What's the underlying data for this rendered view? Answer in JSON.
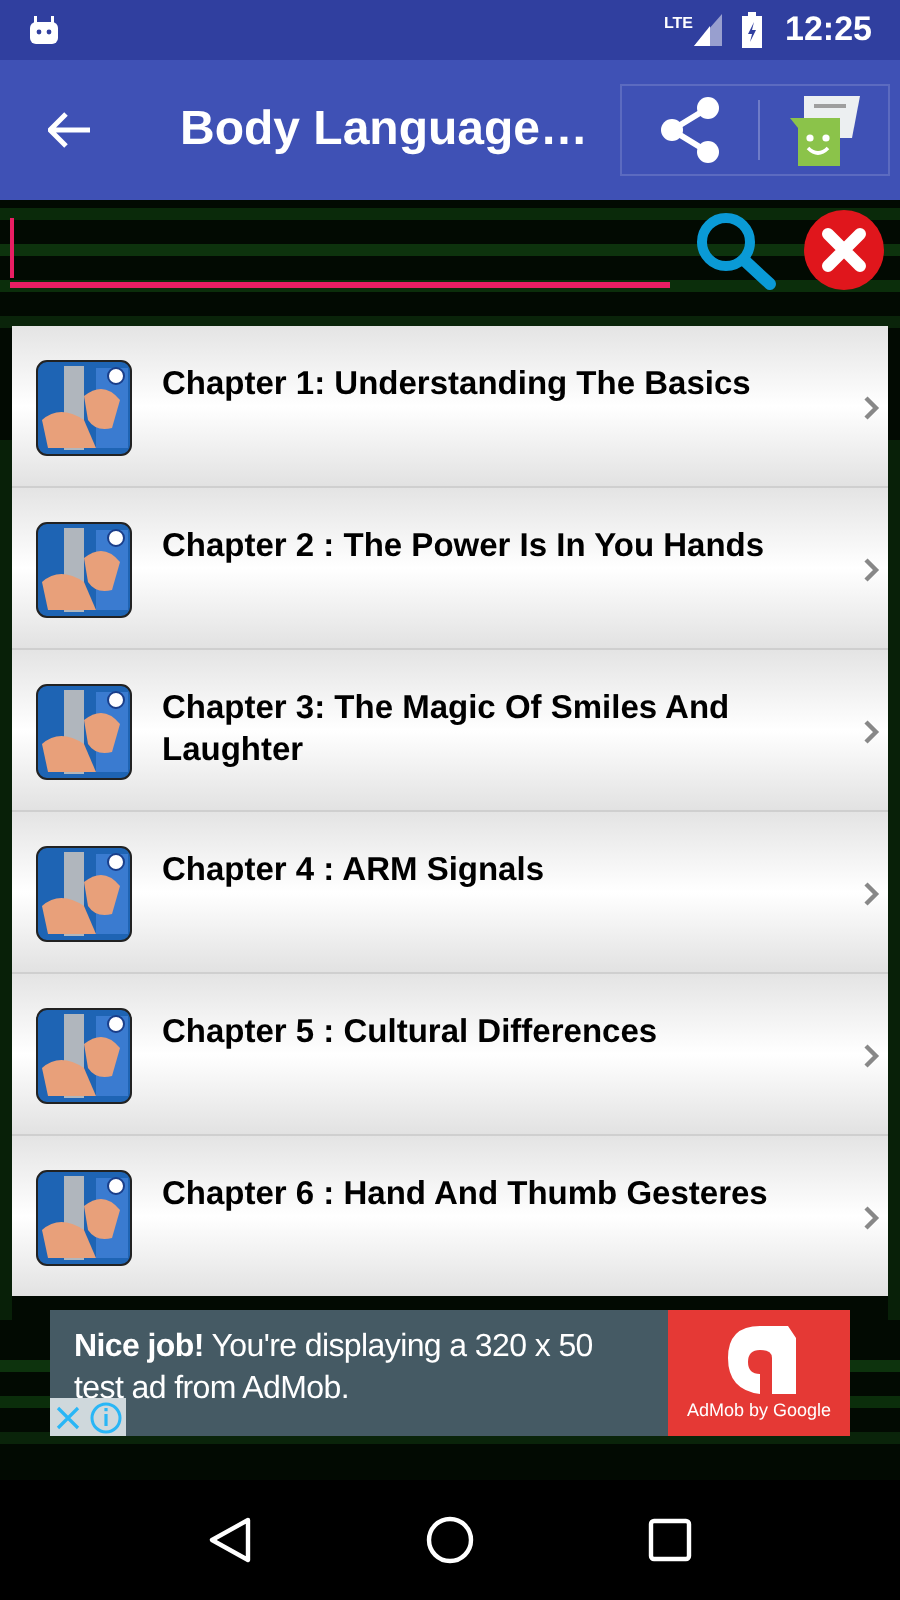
{
  "status_bar": {
    "network": "LTE",
    "time": "12:25"
  },
  "toolbar": {
    "title": "Body Language…"
  },
  "chapters": [
    {
      "title": "Chapter 1: Understanding The Basics"
    },
    {
      "title": "Chapter 2 : The Power Is In You Hands"
    },
    {
      "title": "Chapter 3: The Magic Of Smiles And Laughter"
    },
    {
      "title": "Chapter 4 : ARM Signals"
    },
    {
      "title": "Chapter 5 : Cultural Differences"
    },
    {
      "title": "Chapter 6 : Hand And Thumb Gesteres"
    }
  ],
  "ad": {
    "text": "**Nice job!** You're displaying a 320 x 50 test ad from AdMob.",
    "brand": "AdMob by Google"
  }
}
